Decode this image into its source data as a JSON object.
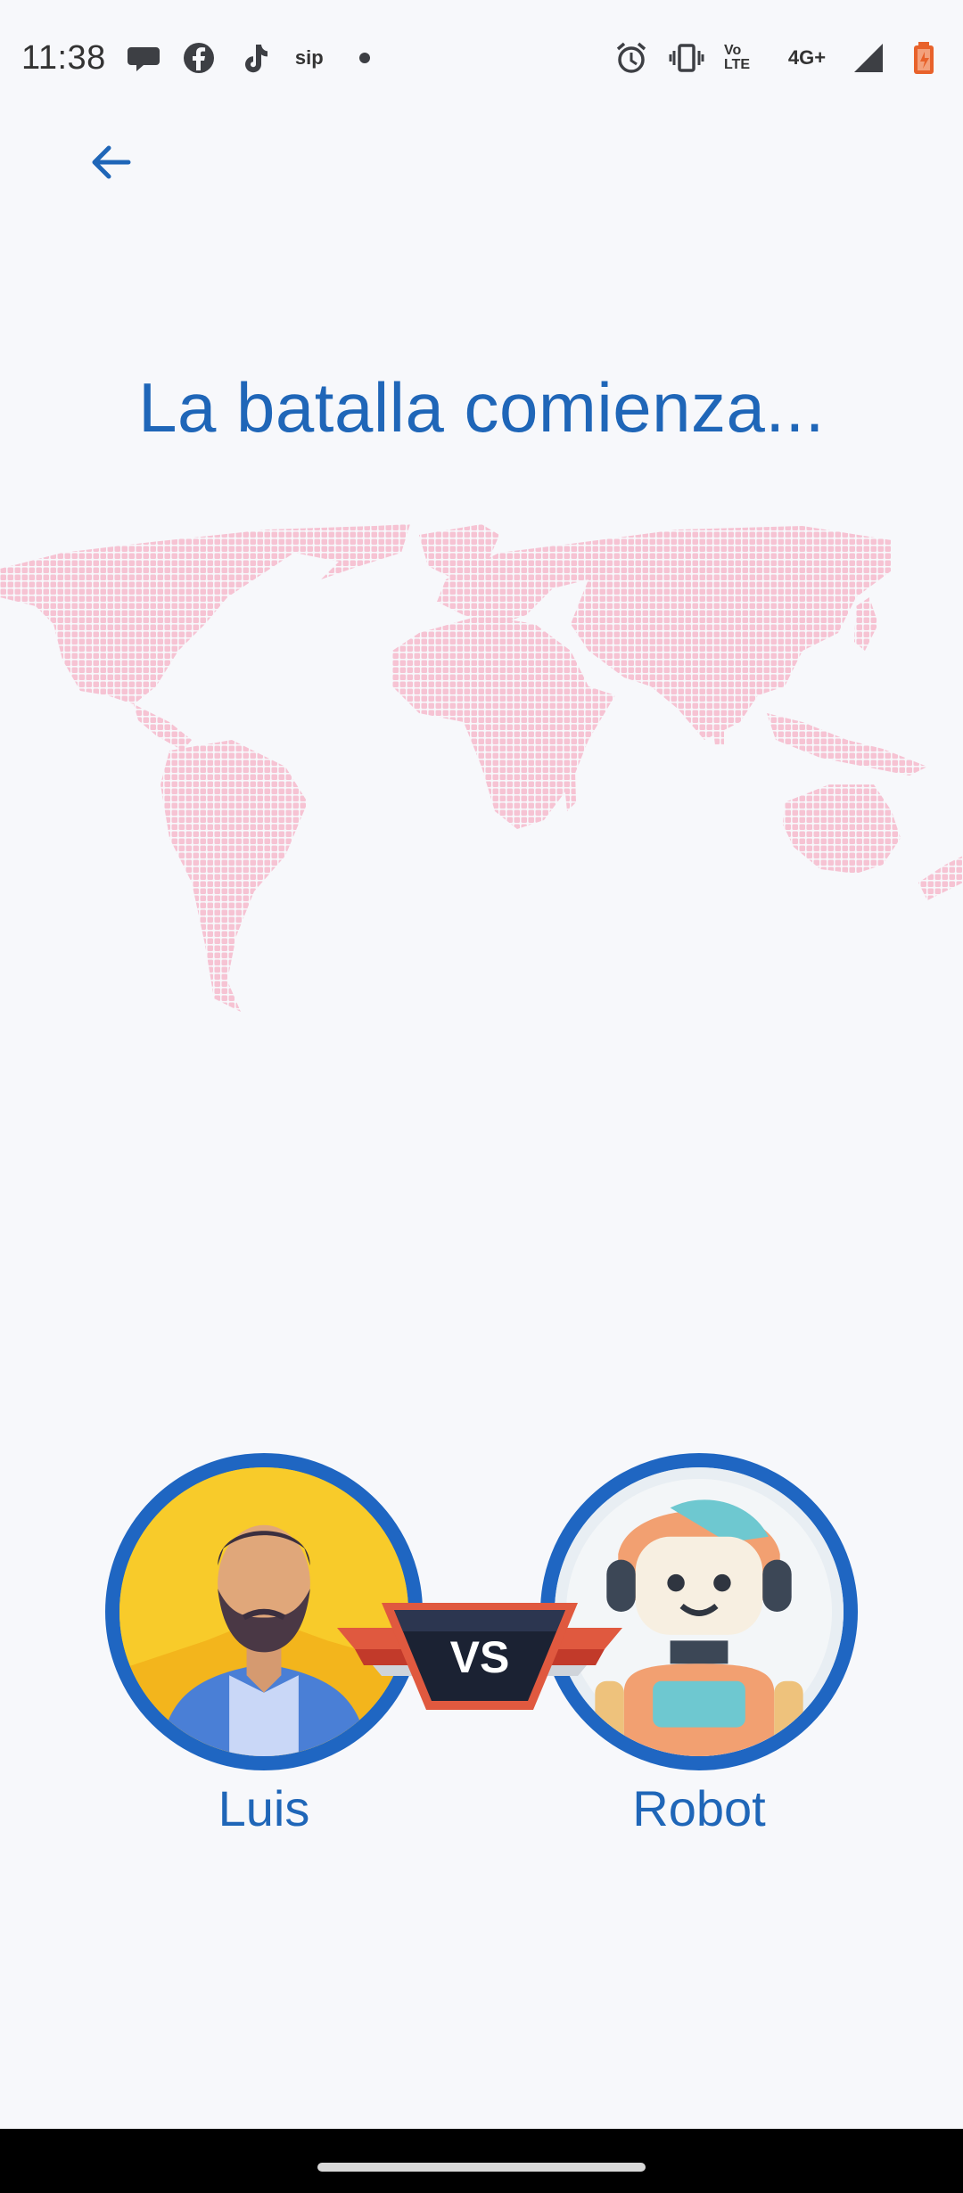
{
  "status_bar": {
    "time": "11:38",
    "left_icons": [
      "chat-bubble-icon",
      "facebook-icon",
      "tiktok-icon",
      "sip-icon",
      "dot-icon"
    ],
    "sip_text": "sip",
    "right_icons": [
      "alarm-icon",
      "vibrate-icon",
      "volte-icon",
      "network-4g-icon",
      "signal-icon",
      "battery-icon"
    ],
    "volte_text": "Vo LTE",
    "network_text": "4G+",
    "battery_color": "#e8622b"
  },
  "header": {
    "back_icon": "arrow-left-icon"
  },
  "main": {
    "title": "La batalla comienza...",
    "map_color": "#f6c3d3"
  },
  "battle": {
    "player_left": {
      "name": "Luis",
      "avatar": "man-avatar"
    },
    "player_right": {
      "name": "Robot",
      "avatar": "robot-avatar"
    },
    "vs_label": "VS",
    "ring_color": "#1f66c2",
    "accent_text_color": "#1f66b8"
  }
}
